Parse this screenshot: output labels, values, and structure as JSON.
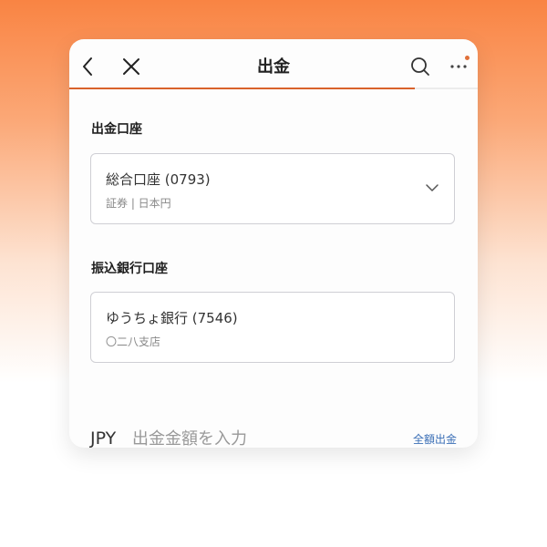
{
  "colors": {
    "accent": "#d9622b",
    "link": "#3b6fb6",
    "notification_dot": "#e0703a"
  },
  "header": {
    "title": "出金",
    "icons": [
      "chevron-left-icon",
      "close-icon",
      "search-icon",
      "more-icon"
    ],
    "progress_fraction": 0.845
  },
  "withdrawal_account": {
    "label": "出金口座",
    "name": "総合口座 (0793)",
    "detail": "証券 | 日本円"
  },
  "bank_account": {
    "label": "振込銀行口座",
    "name": "ゆうちょ銀行 (7546)",
    "detail": "〇二八支店"
  },
  "amount": {
    "currency": "JPY",
    "placeholder": "出金金額を入力",
    "withdraw_all_label": "全額出金"
  }
}
